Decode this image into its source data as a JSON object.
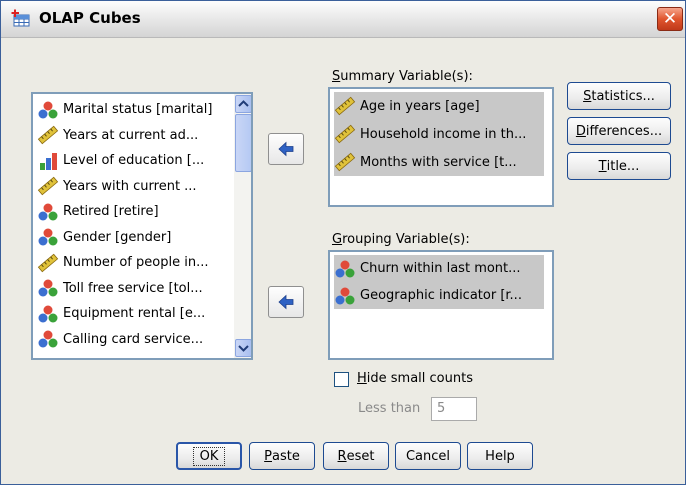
{
  "window": {
    "title": "OLAP Cubes",
    "close_glyph": "✕"
  },
  "source_list": {
    "items": [
      {
        "label": "Marital status [marital]",
        "icon": "nominal-icon"
      },
      {
        "label": "Years at current ad...",
        "icon": "scale-icon"
      },
      {
        "label": "Level of education [...",
        "icon": "ordinal-icon"
      },
      {
        "label": "Years with current ...",
        "icon": "scale-icon"
      },
      {
        "label": "Retired [retire]",
        "icon": "nominal-icon"
      },
      {
        "label": "Gender [gender]",
        "icon": "nominal-icon"
      },
      {
        "label": "Number of people in...",
        "icon": "scale-icon"
      },
      {
        "label": "Toll free service [tol...",
        "icon": "nominal-icon"
      },
      {
        "label": "Equipment rental [e...",
        "icon": "nominal-icon"
      },
      {
        "label": "Calling card service...",
        "icon": "nominal-icon"
      }
    ]
  },
  "summary": {
    "label_pre": "",
    "label_mnemonic": "S",
    "label_post": "ummary Variable(s):",
    "items": [
      {
        "label": "Age in years [age]",
        "icon": "scale-icon"
      },
      {
        "label": "Household income in th...",
        "icon": "scale-icon"
      },
      {
        "label": "Months with service [t...",
        "icon": "scale-icon"
      }
    ]
  },
  "grouping": {
    "label_pre": "",
    "label_mnemonic": "G",
    "label_post": "rouping Variable(s):",
    "items": [
      {
        "label": "Churn within last mont...",
        "icon": "nominal-icon"
      },
      {
        "label": "Geographic indicator [r...",
        "icon": "nominal-icon"
      }
    ]
  },
  "side_buttons": {
    "statistics": {
      "m": "S",
      "rest": "tatistics..."
    },
    "differences": {
      "m": "D",
      "rest": "ifferences..."
    },
    "title": {
      "m": "T",
      "rest": "itle..."
    }
  },
  "options": {
    "hide_small_m": "H",
    "hide_small_rest": "ide small counts",
    "hide_small_checked": false,
    "less_than_label": "Less than",
    "less_than_value": "5"
  },
  "bottom_buttons": {
    "ok": "OK",
    "paste": {
      "m": "P",
      "rest": "aste"
    },
    "reset": {
      "m": "R",
      "rest": "eset"
    },
    "cancel": "Cancel",
    "help": "Help"
  },
  "colors": {
    "nominal_red": "#e04a3a",
    "nominal_blue": "#3b6fd0",
    "nominal_green": "#3aa23a",
    "scale_ruler": "#e0c23a",
    "selection": "#c8c8c8",
    "arrow_blue": "#2f62c4"
  }
}
